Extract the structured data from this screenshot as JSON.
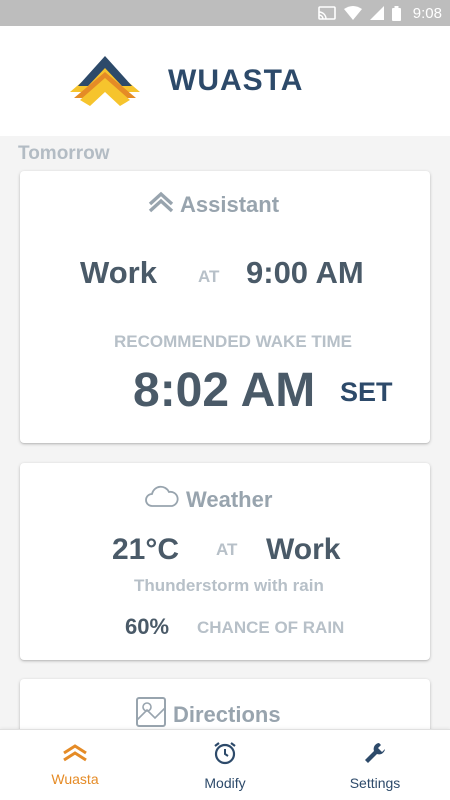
{
  "status_bar": {
    "time": "9:08",
    "icons": [
      "cast-icon",
      "wifi-icon",
      "signal-icon",
      "battery-icon"
    ]
  },
  "header": {
    "title": "WUASTA"
  },
  "section": {
    "title": "Tomorrow"
  },
  "assistant": {
    "title": "Assistant",
    "destination": "Work",
    "at": "AT",
    "arrival_time": "9:00 AM",
    "recommended_label": "RECOMMENDED WAKE TIME",
    "wake_time": "8:02 AM",
    "set_label": "SET"
  },
  "weather": {
    "title": "Weather",
    "temperature": "21°C",
    "at": "AT",
    "location": "Work",
    "condition": "Thunderstorm with rain",
    "rain_chance": "60%",
    "rain_label": "CHANCE OF RAIN"
  },
  "directions": {
    "title": "Directions"
  },
  "bottom_nav": {
    "items": [
      {
        "label": "Wuasta",
        "icon": "wuasta-icon",
        "active": true
      },
      {
        "label": "Modify",
        "icon": "alarm-clock-icon",
        "active": false
      },
      {
        "label": "Settings",
        "icon": "wrench-icon",
        "active": false
      }
    ]
  },
  "colors": {
    "primary": "#2d4a6a",
    "accent": "#e58b26",
    "logo_yellow": "#f6c42d",
    "logo_orange": "#e58b26",
    "muted": "#98a4ae"
  }
}
